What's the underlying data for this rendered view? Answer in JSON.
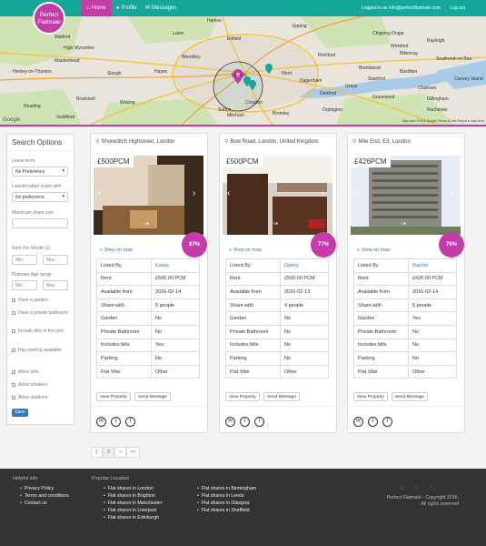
{
  "nav": {
    "logo_line1": "Perfect",
    "logo_line2": "Flatmate",
    "home": "Home",
    "profile": "Profile",
    "messages": "Messages",
    "logged_in": "Logged in as info@perfectflatmate.com",
    "logout": "Log out"
  },
  "map": {
    "labels": [
      "Harlow",
      "Watford",
      "Enfield",
      "Epping",
      "Chipping Ongar",
      "Brentwood",
      "Billericay",
      "Rayleigh",
      "Southend-on-Sea",
      "Romford",
      "Basildon",
      "Grays",
      "Dartford",
      "Henley-on-Thames",
      "Maidenhead",
      "Slough",
      "Reading",
      "Bracknell",
      "Hayes",
      "Wembley",
      "London",
      "Croydon",
      "Sutton",
      "Guildford",
      "Woking",
      "Mitcham",
      "Bromley",
      "Orpington",
      "Gillingham",
      "Chatham",
      "Gravesend",
      "Luton",
      "Rochester",
      "Ilford",
      "Dagenham",
      "Canvey Island",
      "Wickford",
      "High Wycombe",
      "Stanford"
    ],
    "copyright": "Map data ©2016 Google   Terms of Use   Report a map error",
    "google": "Google"
  },
  "sidebar": {
    "title": "Search Options",
    "lease_label": "Lease term",
    "lease_value": "No Preference",
    "share_label": "I would rather share with",
    "share_value": "No preference",
    "max_share_label": "Maximum share size",
    "rent_label": "Rent Per Month (£)",
    "rent_min": "Min",
    "rent_max": "Max",
    "age_label": "Flatmate Age range",
    "age_min": "Min",
    "age_max": "Max",
    "checks": [
      "Have a garden",
      "Have a private bathroom",
      "Include bills in the rent",
      "Has parking available"
    ],
    "allow": [
      "Allow pets",
      "Allow smokers",
      "Allow students"
    ],
    "save": "Save"
  },
  "cards": [
    {
      "location": "Shoreditch Highstreet, London",
      "price": "£500PCM",
      "match": "87%",
      "view_map": "View on map",
      "rows": [
        [
          "Listed By",
          "Kasey"
        ],
        [
          "Rent",
          "£500.00 PCM"
        ],
        [
          "Available from",
          "2016-02-14"
        ],
        [
          "Share with",
          "5 people"
        ],
        [
          "Garden",
          "No"
        ],
        [
          "Private Bathroom",
          "No"
        ],
        [
          "Includes bills",
          "Yes"
        ],
        [
          "Parking",
          "No"
        ],
        [
          "Flat Vibe",
          "Other"
        ]
      ],
      "view_btn": "View Property",
      "send_btn": "Send Message"
    },
    {
      "location": "Bow Road, London, United Kingdom",
      "price": "£500PCM",
      "match": "77%",
      "view_map": "View on map",
      "rows": [
        [
          "Listed By",
          "Danny"
        ],
        [
          "Rent",
          "£500.00 PCM"
        ],
        [
          "Available from",
          "2016-02-13"
        ],
        [
          "Share with",
          "4 people"
        ],
        [
          "Garden",
          "No"
        ],
        [
          "Private Bathroom",
          "No"
        ],
        [
          "Includes bills",
          "No"
        ],
        [
          "Parking",
          "No"
        ],
        [
          "Flat Vibe",
          "Other"
        ]
      ],
      "view_btn": "View Property",
      "send_btn": "Send Message"
    },
    {
      "location": "Mile End, E3, London",
      "price": "£426PCM",
      "match": "76%",
      "view_map": "View on map",
      "rows": [
        [
          "Listed By",
          "Rachel"
        ],
        [
          "Rent",
          "£426.00 PCM"
        ],
        [
          "Available from",
          "2016-02-14"
        ],
        [
          "Share with",
          "5 people"
        ],
        [
          "Garden",
          "Yes"
        ],
        [
          "Private Bathroom",
          "No"
        ],
        [
          "Includes bills",
          "No"
        ],
        [
          "Parking",
          "No"
        ],
        [
          "Flat Vibe",
          "Other"
        ]
      ],
      "view_btn": "View Property",
      "send_btn": "Send Message"
    }
  ],
  "pagination": [
    "1",
    "2",
    ">",
    ">>"
  ],
  "footer": {
    "helpful_title": "Helpful info",
    "helpful": [
      "Privacy Policy",
      "Terms and conditions",
      "Contact us"
    ],
    "popular_title": "Popular Location",
    "col1": [
      "Flat shares in London",
      "Flat shares in Brighton",
      "Flat shares in Manchester",
      "Flat shares in Liverpool",
      "Flat shares in Edinburgh"
    ],
    "col2": [
      "Flat shares in Birmingham",
      "Flat shares in Leeds",
      "Flat shares in Glasgow",
      "Flat shares in Sheffield"
    ],
    "copy1": "Perfect Flatmate - Copyright 2016.",
    "copy2": "All rights reserved"
  },
  "colors": {
    "teal": "#15a79b",
    "magenta": "#c43ca7",
    "link": "#337ab7",
    "footer": "#333333"
  }
}
